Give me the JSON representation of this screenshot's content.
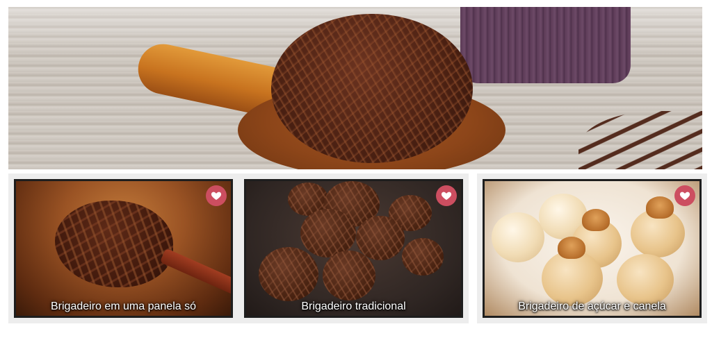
{
  "hero": {
    "image_alt": "brigadeiro"
  },
  "cards": [
    {
      "caption": "Brigadeiro em uma panela só",
      "favorite_icon": "heart-icon"
    },
    {
      "caption": "Brigadeiro tradicional",
      "favorite_icon": "heart-icon"
    },
    {
      "caption": "Brigadeiro de açúcar e canela",
      "favorite_icon": "heart-icon"
    }
  ],
  "colors": {
    "favorite_button": "#cc4e60",
    "card_background": "#ededed",
    "card_border": "#1e1e1e"
  }
}
